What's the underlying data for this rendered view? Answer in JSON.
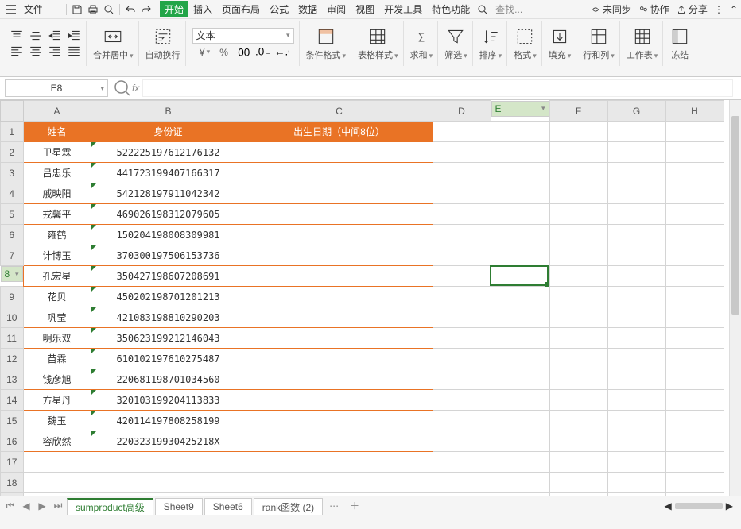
{
  "menu": {
    "file": "文件",
    "items": [
      "开始",
      "插入",
      "页面布局",
      "公式",
      "数据",
      "审阅",
      "视图",
      "开发工具",
      "特色功能"
    ],
    "search": "查找...",
    "sync": "未同步",
    "collab": "协作",
    "share": "分享"
  },
  "ribbon": {
    "merge": "合并居中",
    "wrap": "自动换行",
    "numfmt": "文本",
    "condfmt": "条件格式",
    "tablestyle": "表格样式",
    "sum": "求和",
    "filter": "筛选",
    "sort": "排序",
    "format": "格式",
    "fill": "填充",
    "rowcol": "行和列",
    "sheet": "工作表",
    "freeze": "冻结"
  },
  "namebox": "E8",
  "cols": [
    "A",
    "B",
    "C",
    "D",
    "E",
    "F",
    "G",
    "H"
  ],
  "headers": {
    "A": "姓名",
    "B": "身份证",
    "C": "出生日期（中间8位）"
  },
  "rows": [
    {
      "A": "卫星霖",
      "B": "522225197612176132"
    },
    {
      "A": "吕忠乐",
      "B": "441723199407166317"
    },
    {
      "A": "戚映阳",
      "B": "542128197911042342"
    },
    {
      "A": "戎馨平",
      "B": "469026198312079605"
    },
    {
      "A": "雍鹤",
      "B": "150204198008309981"
    },
    {
      "A": "计博玉",
      "B": "370300197506153736"
    },
    {
      "A": "孔宏星",
      "B": "350427198607208691"
    },
    {
      "A": "花贝",
      "B": "450202198701201213"
    },
    {
      "A": "巩莹",
      "B": "421083198810290203"
    },
    {
      "A": "明乐双",
      "B": "350623199212146043"
    },
    {
      "A": "苗霖",
      "B": "610102197610275487"
    },
    {
      "A": "钱彦旭",
      "B": "220681198701034560"
    },
    {
      "A": "方星丹",
      "B": "320103199204113833"
    },
    {
      "A": "魏玉",
      "B": "420114197808258199"
    },
    {
      "A": "容欣然",
      "B": "22032319930425218X"
    }
  ],
  "tabs": [
    "sumproduct高级",
    "Sheet9",
    "Sheet6",
    "rank函数 (2)"
  ],
  "sel": {
    "col": "E",
    "row": 8
  }
}
